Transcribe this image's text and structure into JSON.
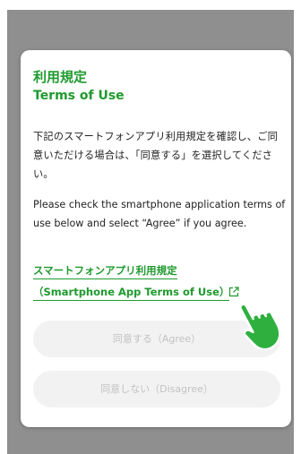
{
  "dialog": {
    "title_ja": "利用規定",
    "title_en": "Terms of Use",
    "message_ja": "下記のスマートフォンアプリ利用規定を確認し、ご同意いただける場合は、「同意する」を選択してください。",
    "message_en": "Please check the smartphone application terms of use below and select “Agree” if you agree.",
    "link_ja": "スマートフォンアプリ利用規定",
    "link_en": "（Smartphone App Terms of Use）",
    "agree_button": "同意する（Agree）",
    "disagree_button": "同意しない（Disagree）"
  },
  "icons": {
    "external_link": "external-link-icon",
    "pointer": "pointing-hand-icon"
  },
  "colors": {
    "accent": "#1f9a2e",
    "overlay": "#8f8f8f",
    "button_bg": "#f2f2f2",
    "button_text": "#c2c2c2",
    "hand": "#2eaf3e"
  }
}
